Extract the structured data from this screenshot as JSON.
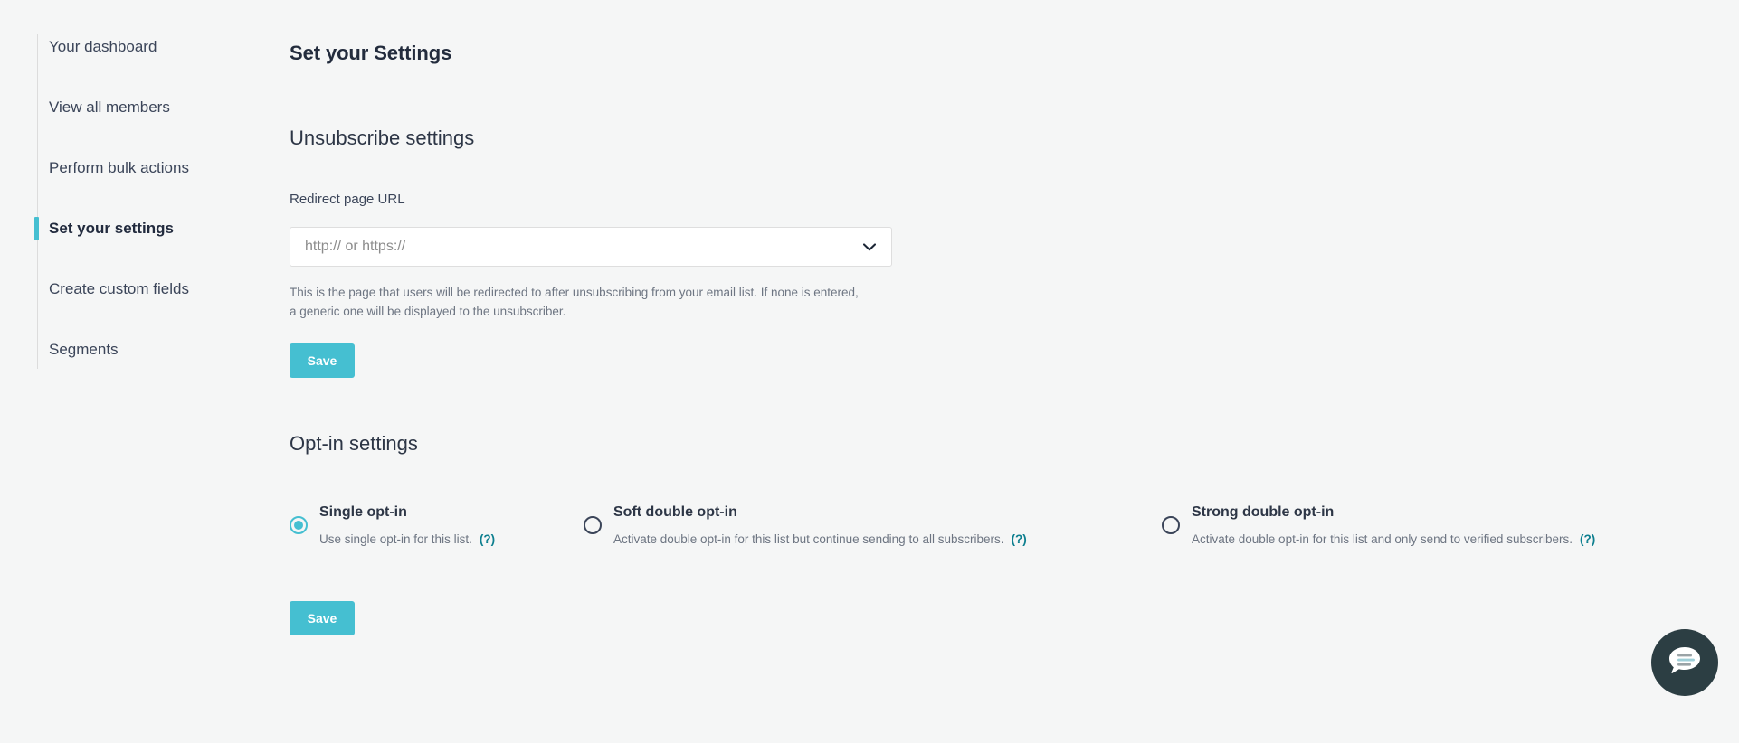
{
  "sidebar": {
    "items": [
      {
        "label": "Your dashboard",
        "active": false
      },
      {
        "label": "View all members",
        "active": false
      },
      {
        "label": "Perform bulk actions",
        "active": false
      },
      {
        "label": "Set your settings",
        "active": true
      },
      {
        "label": "Create custom fields",
        "active": false
      },
      {
        "label": "Segments",
        "active": false
      }
    ]
  },
  "main": {
    "page_title": "Set your Settings",
    "unsubscribe": {
      "section_title": "Unsubscribe settings",
      "field_label": "Redirect page URL",
      "url_value": "",
      "url_placeholder": "http:// or https://",
      "dropdown_icon": "chevron-down-icon",
      "help_text": "This is the page that users will be redirected to after unsubscribing from your email list. If none is entered, a generic one will be displayed to the unsubscriber.",
      "save_label": "Save"
    },
    "optin": {
      "section_title": "Opt-in settings",
      "save_label": "Save",
      "help_marker": "(?)",
      "options": [
        {
          "name": "Single opt-in",
          "description": "Use single opt-in for this list.",
          "selected": true
        },
        {
          "name": "Soft double opt-in",
          "description": "Activate double opt-in for this list but continue sending to all subscribers.",
          "selected": false
        },
        {
          "name": "Strong double opt-in",
          "description": "Activate double opt-in for this list and only send to verified subscribers.",
          "selected": false
        }
      ]
    }
  },
  "chat": {
    "icon": "chat-bubble-icon"
  },
  "colors": {
    "accent": "#45bfd1",
    "help_link": "#0d7f8f",
    "text_dark": "#2d3646",
    "text_muted": "#6d7582",
    "background": "#f5f6f6",
    "chat_bg": "#2c3e43"
  }
}
